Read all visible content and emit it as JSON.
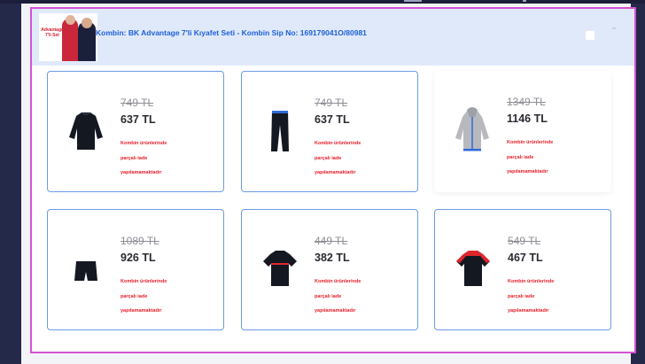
{
  "header": {
    "thumb_text": "Advantage 7'li Set",
    "title": "Kombin: BK Advantage 7'li Kıyafet Seti - Kombin Sip No: 169179041O/80981"
  },
  "products": [
    {
      "old_price": "749 TL",
      "new_price": "637 TL",
      "note": [
        "Kombin ürünlerinde",
        "parçalı iade",
        "yapılamamaktadır"
      ],
      "image": "sweatshirt-icon"
    },
    {
      "old_price": "749 TL",
      "new_price": "637 TL",
      "note": [
        "Kombin ürünlerinde",
        "parçalı iade",
        "yapılamamaktadır"
      ],
      "image": "track-pants-icon"
    },
    {
      "old_price": "1349 TL",
      "new_price": "1146 TL",
      "note": [
        "Kombin ürünlerinde",
        "parçalı iade",
        "yapılamamaktadır"
      ],
      "image": "hoodie-icon"
    },
    {
      "old_price": "1089 TL",
      "new_price": "926 TL",
      "note": [
        "Kombin ürünlerinde",
        "parçalı iade",
        "yapılamamaktadır"
      ],
      "image": "shorts-icon"
    },
    {
      "old_price": "449 TL",
      "new_price": "382 TL",
      "note": [
        "Kombin ürünlerinde",
        "parçalı iade",
        "yapılamamaktadır"
      ],
      "image": "tshirt-icon"
    },
    {
      "old_price": "549 TL",
      "new_price": "467 TL",
      "note": [
        "Kombin ürünlerinde",
        "parçalı iade",
        "yapılamamaktadır"
      ],
      "image": "polo-shirt-icon"
    }
  ]
}
